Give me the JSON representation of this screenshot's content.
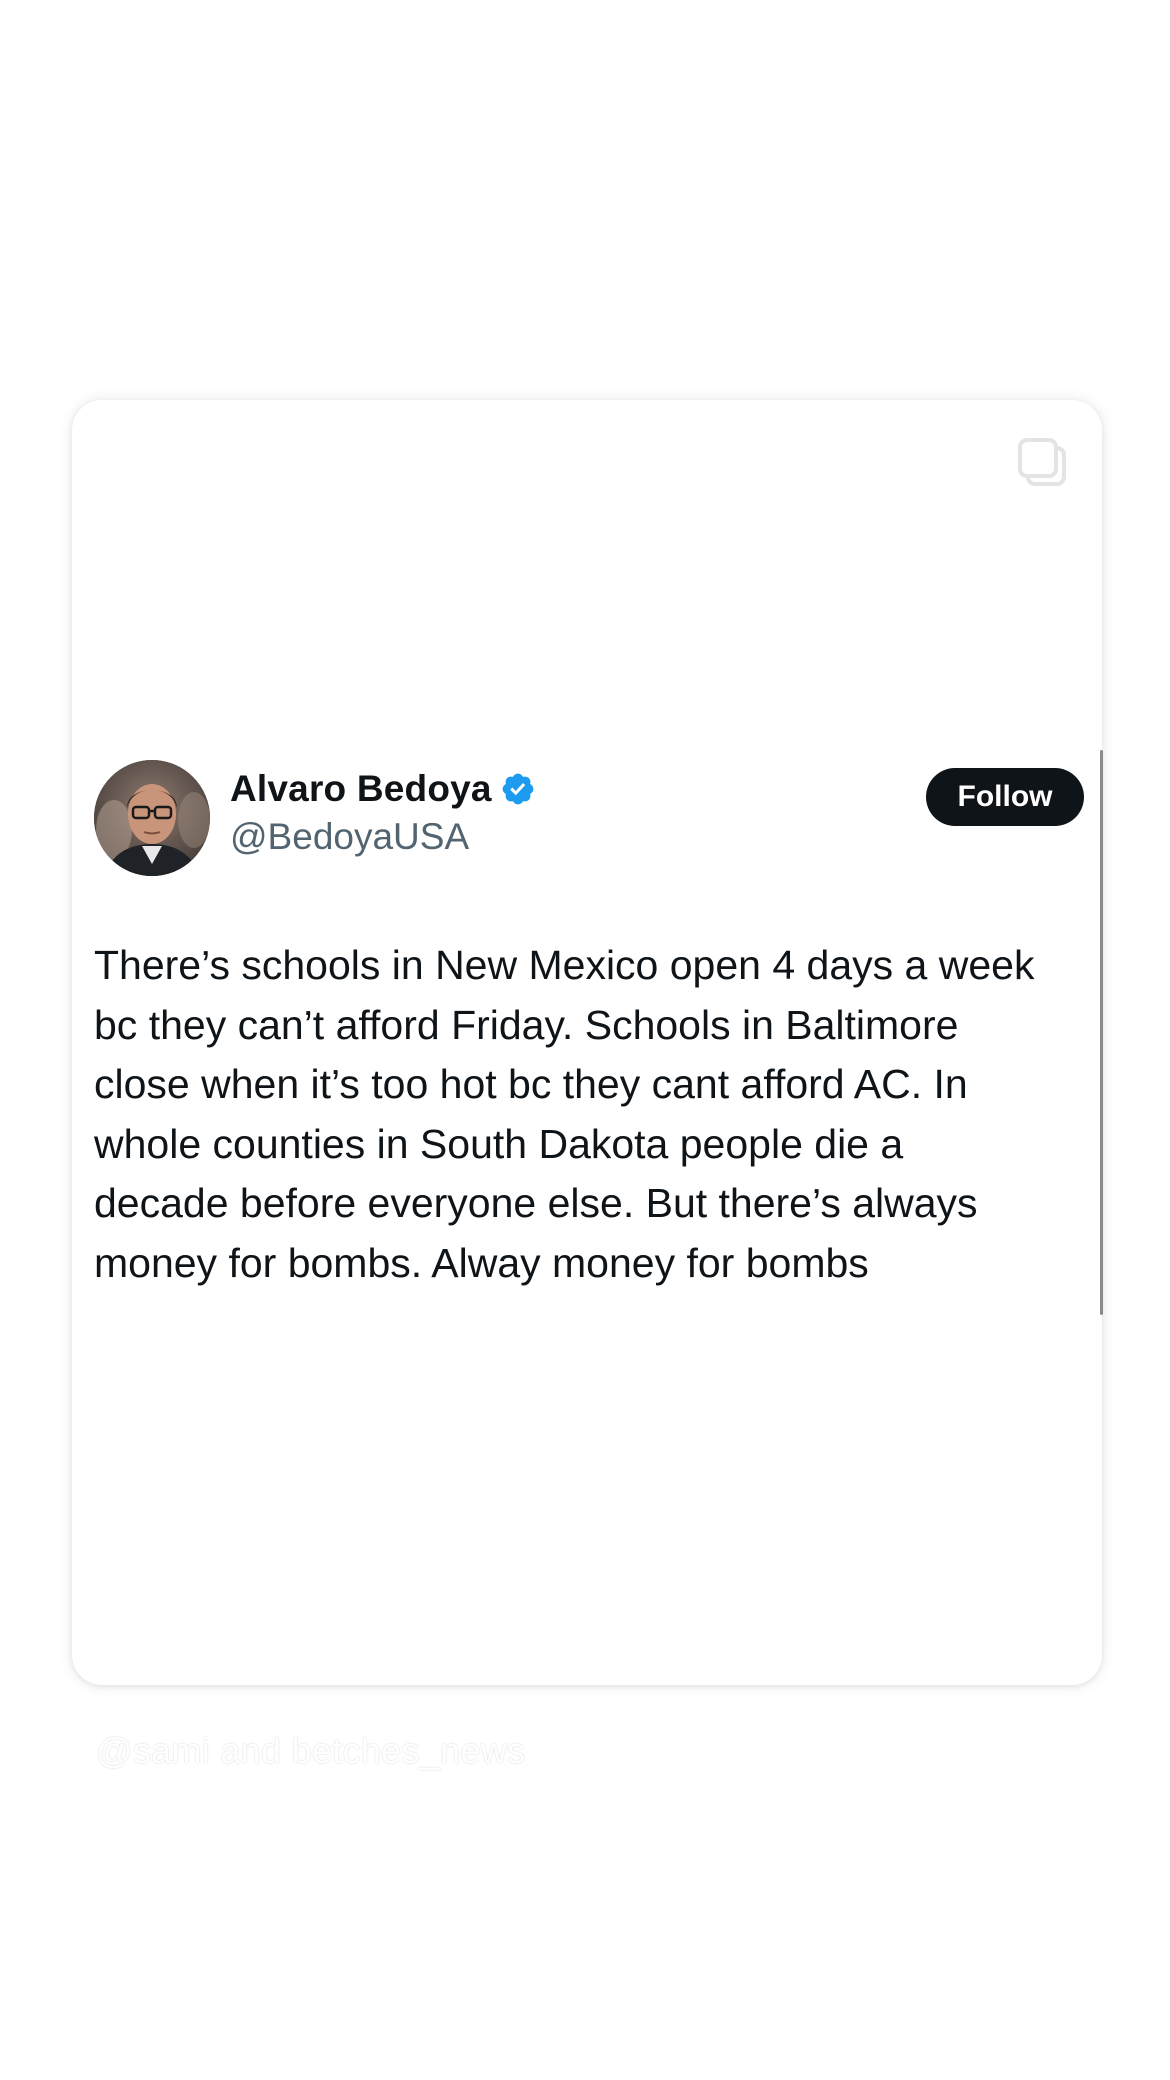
{
  "tweet": {
    "display_name": "Alvaro Bedoya",
    "handle": "@BedoyaUSA",
    "verified": true,
    "verified_color": "#1d9bf0",
    "follow_label": "Follow",
    "text": "There’s schools in New Mexico open 4 days a week\nbc they can’t afford Friday. Schools in Baltimore\nclose when it’s too hot bc they cant afford AC. In\nwhole counties in South Dakota people die a\ndecade before everyone else. But there’s always\nmoney for bombs. Alway money for bombs"
  },
  "card": {
    "corner_icon": "copy-icon"
  },
  "watermark": {
    "text": "@sami and betches_news"
  },
  "colors": {
    "text_primary": "#0f1419",
    "text_secondary": "#536471",
    "button_bg": "#0f1419",
    "button_text": "#ffffff"
  }
}
